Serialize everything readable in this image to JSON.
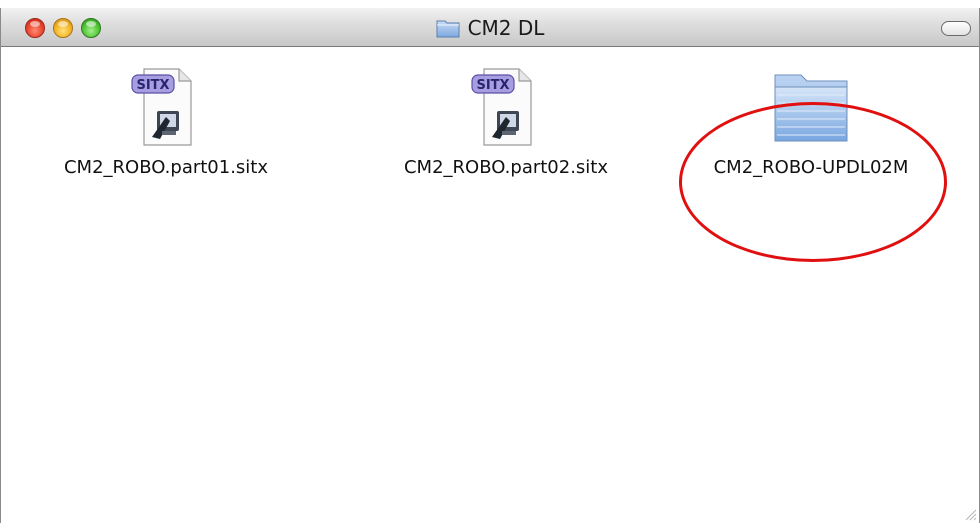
{
  "window": {
    "title": "CM2 DL"
  },
  "files": [
    {
      "name": "CM2_ROBO.part01.sitx",
      "badge": "SITX",
      "icon": "stuffit-archive-icon"
    },
    {
      "name": "CM2_ROBO.part02.sitx",
      "badge": "SITX",
      "icon": "stuffit-archive-icon"
    },
    {
      "name": "CM2_ROBO-UPDL02M",
      "icon": "folder-icon"
    }
  ],
  "colors": {
    "highlight_ring": "#e01010",
    "close_button": "#e8412b",
    "minimize_button": "#f3b123",
    "zoom_button": "#4cc233",
    "folder": "#8fb8ea"
  }
}
